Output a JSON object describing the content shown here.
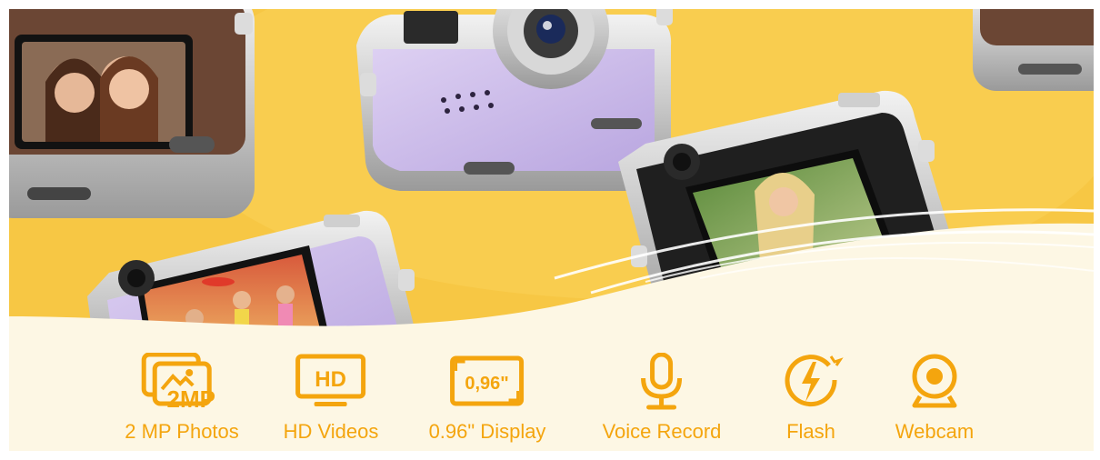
{
  "features": [
    {
      "label": "2 MP Photos",
      "icon": "photos-2mp-icon",
      "badge": "2MP"
    },
    {
      "label": "HD Videos",
      "icon": "hd-video-icon",
      "badge": "HD"
    },
    {
      "label": "0.96\" Display",
      "icon": "display-size-icon",
      "badge": "0,96\""
    },
    {
      "label": "Voice Record",
      "icon": "microphone-icon"
    },
    {
      "label": "Flash",
      "icon": "flash-icon"
    },
    {
      "label": "Webcam",
      "icon": "webcam-icon"
    }
  ],
  "colors": {
    "background": "#f7c744",
    "panel": "#fdf7e4",
    "accent": "#f4a50e"
  }
}
